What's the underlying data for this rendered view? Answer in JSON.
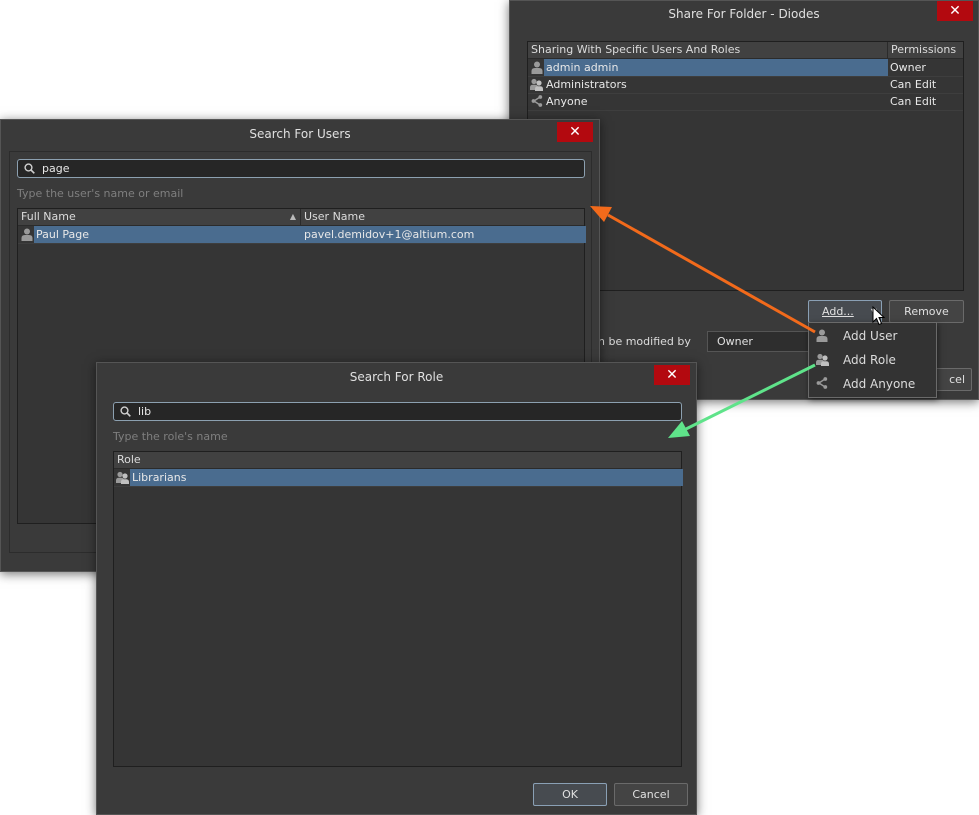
{
  "share_dialog": {
    "title": "Share For Folder - Diodes",
    "columns": {
      "sharing": "Sharing With Specific Users And Roles",
      "permissions": "Permissions"
    },
    "rows": [
      {
        "name": "admin admin",
        "permission": "Owner",
        "icon": "user-icon"
      },
      {
        "name": "Administrators",
        "permission": "Can Edit",
        "icon": "role-icon"
      },
      {
        "name": "Anyone",
        "permission": "Can Edit",
        "icon": "share-icon"
      }
    ],
    "add_label": "Add...",
    "remove_label": "Remove",
    "modified_by_label": "n be modified by",
    "modified_by_value": "Owner",
    "cancel_partial": "cel"
  },
  "add_menu": {
    "items": [
      {
        "label": "Add User",
        "icon": "user-icon"
      },
      {
        "label": "Add Role",
        "icon": "role-icon"
      },
      {
        "label": "Add Anyone",
        "icon": "share-icon"
      }
    ]
  },
  "users_dialog": {
    "title": "Search For Users",
    "search_value": "page",
    "hint": "Type the user's name or email",
    "columns": {
      "full_name": "Full Name",
      "user_name": "User Name"
    },
    "rows": [
      {
        "full_name": "Paul Page",
        "user_name": "pavel.demidov+1@altium.com"
      }
    ]
  },
  "role_dialog": {
    "title": "Search For Role",
    "search_value": "lib",
    "hint": "Type the role's name",
    "columns": {
      "role": "Role"
    },
    "rows": [
      {
        "role": "Librarians"
      }
    ],
    "ok_label": "OK",
    "cancel_label": "Cancel"
  },
  "colors": {
    "orange_arrow": "#f26a1b",
    "green_arrow": "#5fe38a",
    "close": "#b3090f",
    "selection": "#4a6c8f"
  }
}
